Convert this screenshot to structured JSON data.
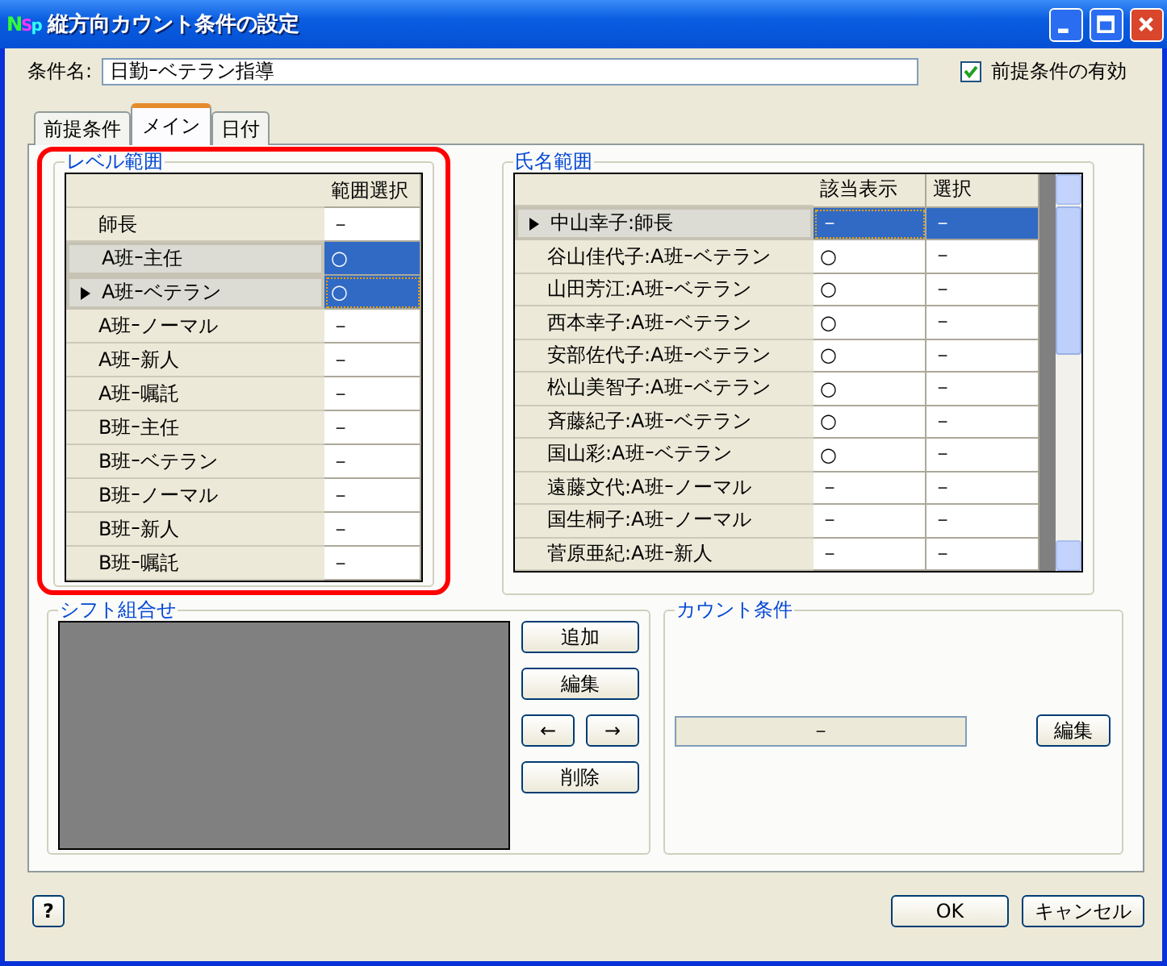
{
  "window": {
    "logo": "NSp",
    "title": "縦方向カウント条件の設定"
  },
  "condition_name": {
    "label": "条件名:",
    "value": "日勤ｰベテラン指導"
  },
  "prerequisite_checkbox": {
    "label": "前提条件の有効",
    "checked": true
  },
  "tabs": [
    {
      "label": "前提条件",
      "selected": false
    },
    {
      "label": "メイン",
      "selected": true
    },
    {
      "label": "日付",
      "selected": false
    }
  ],
  "level_range": {
    "title": "レベル範囲",
    "highlighted": true,
    "columns": [
      "範囲選択"
    ],
    "rows": [
      {
        "label": "師長",
        "value": "－",
        "selected": false,
        "current": false
      },
      {
        "label": "A班ｰ主任",
        "value": "○",
        "selected": true,
        "current": false
      },
      {
        "label": "A班ｰベテラン",
        "value": "○",
        "selected": true,
        "current": true
      },
      {
        "label": "A班ｰノーマル",
        "value": "－",
        "selected": false,
        "current": false
      },
      {
        "label": "A班ｰ新人",
        "value": "－",
        "selected": false,
        "current": false
      },
      {
        "label": "A班ｰ嘱託",
        "value": "－",
        "selected": false,
        "current": false
      },
      {
        "label": "B班ｰ主任",
        "value": "－",
        "selected": false,
        "current": false
      },
      {
        "label": "B班ｰベテラン",
        "value": "－",
        "selected": false,
        "current": false
      },
      {
        "label": "B班ｰノーマル",
        "value": "－",
        "selected": false,
        "current": false
      },
      {
        "label": "B班ｰ新人",
        "value": "－",
        "selected": false,
        "current": false
      },
      {
        "label": "B班ｰ嘱託",
        "value": "－",
        "selected": false,
        "current": false
      }
    ]
  },
  "name_range": {
    "title": "氏名範囲",
    "columns": [
      "該当表示",
      "選択"
    ],
    "rows": [
      {
        "label": "中山幸子:師長",
        "match": "－",
        "choice": "－",
        "selected": true,
        "current": true
      },
      {
        "label": "谷山佳代子:A班ｰベテラン",
        "match": "○",
        "choice": "－",
        "selected": false,
        "current": false
      },
      {
        "label": "山田芳江:A班ｰベテラン",
        "match": "○",
        "choice": "－",
        "selected": false,
        "current": false
      },
      {
        "label": "西本幸子:A班ｰベテラン",
        "match": "○",
        "choice": "－",
        "selected": false,
        "current": false
      },
      {
        "label": "安部佐代子:A班ｰベテラン",
        "match": "○",
        "choice": "－",
        "selected": false,
        "current": false
      },
      {
        "label": "松山美智子:A班ｰベテラン",
        "match": "○",
        "choice": "－",
        "selected": false,
        "current": false
      },
      {
        "label": "斉藤紀子:A班ｰベテラン",
        "match": "○",
        "choice": "－",
        "selected": false,
        "current": false
      },
      {
        "label": "国山彩:A班ｰベテラン",
        "match": "○",
        "choice": "－",
        "selected": false,
        "current": false
      },
      {
        "label": "遠藤文代:A班ｰノーマル",
        "match": "－",
        "choice": "－",
        "selected": false,
        "current": false
      },
      {
        "label": "国生桐子:A班ｰノーマル",
        "match": "－",
        "choice": "－",
        "selected": false,
        "current": false
      },
      {
        "label": "菅原亜紀:A班ｰ新人",
        "match": "－",
        "choice": "－",
        "selected": false,
        "current": false
      }
    ]
  },
  "shift_combination": {
    "title": "シフト組合せ",
    "add_button": "追加",
    "edit_button": "編集",
    "left_button": "←",
    "right_button": "→",
    "delete_button": "削除"
  },
  "count_condition": {
    "title": "カウント条件",
    "value": "－",
    "edit_button": "編集"
  },
  "help_button": "?",
  "buttons": [
    "OK",
    "キャンセル"
  ]
}
